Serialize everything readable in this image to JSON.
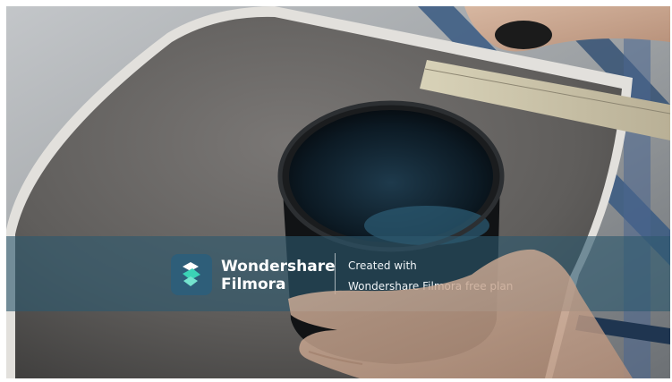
{
  "watermark": {
    "brand_line_1": "Wondershare",
    "brand_line_2": "Filmora",
    "caption_line_1": "Created with",
    "caption_line_2": "Wondershare Filmora free plan"
  },
  "colors": {
    "banner": "#2d586e",
    "logo_bg": "#2e5e79",
    "logo_mark": "#3bd3b6"
  }
}
